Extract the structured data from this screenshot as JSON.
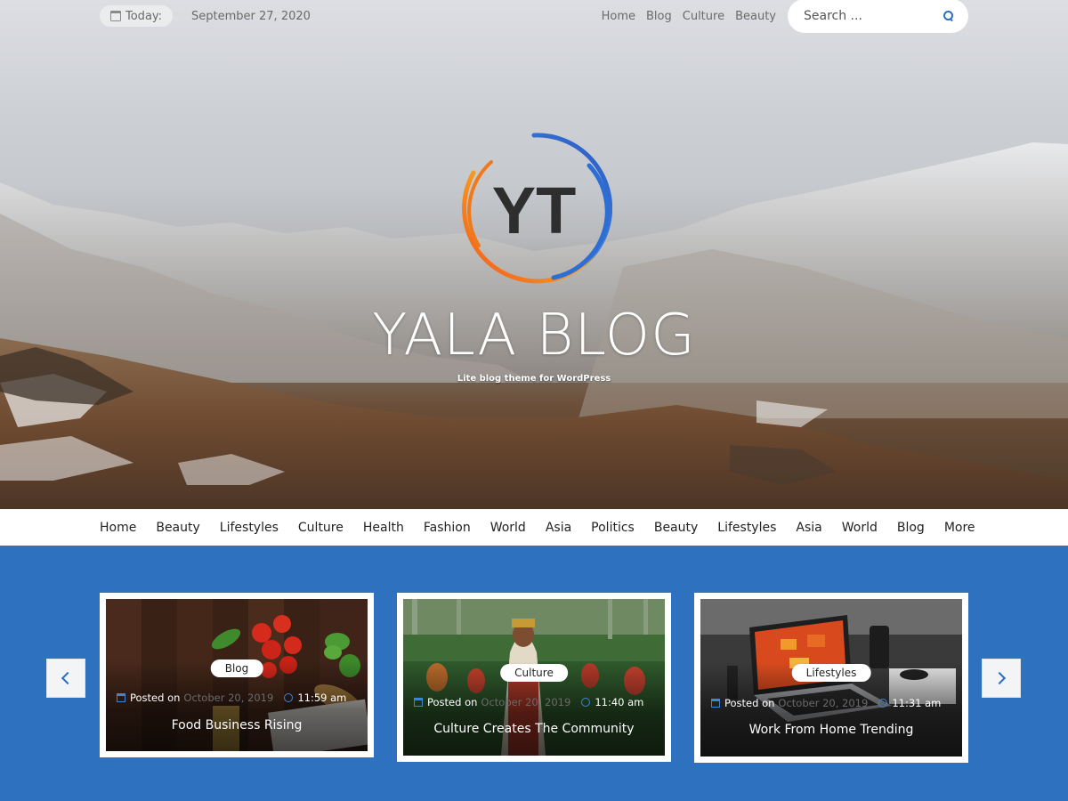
{
  "topbar": {
    "today_label": "Today:",
    "date": "September 27, 2020",
    "nav": [
      "Home",
      "Blog",
      "Culture",
      "Beauty"
    ],
    "search_placeholder": "Search ..."
  },
  "hero": {
    "logo_text": "YT",
    "title": "YALA BLOG",
    "tagline": "Lite blog theme for WordPress"
  },
  "main_nav": [
    "Home",
    "Beauty",
    "Lifestyles",
    "Culture",
    "Health",
    "Fashion",
    "World",
    "Asia",
    "Politics",
    "Beauty",
    "Lifestyles",
    "Asia",
    "World",
    "Blog",
    "More"
  ],
  "slider": {
    "background": "#2e72bf",
    "cards": [
      {
        "category": "Blog",
        "posted_on": "Posted on",
        "date": "October 20, 2019",
        "time": "11:59 am",
        "title": "Food Business Rising"
      },
      {
        "category": "Culture",
        "posted_on": "Posted on",
        "date": "October 20, 2019",
        "time": "11:40 am",
        "title": "Culture Creates The Community"
      },
      {
        "category": "Lifestyles",
        "posted_on": "Posted on",
        "date": "October 20, 2019",
        "time": "11:31 am",
        "title": "Work From Home Trending"
      }
    ]
  }
}
